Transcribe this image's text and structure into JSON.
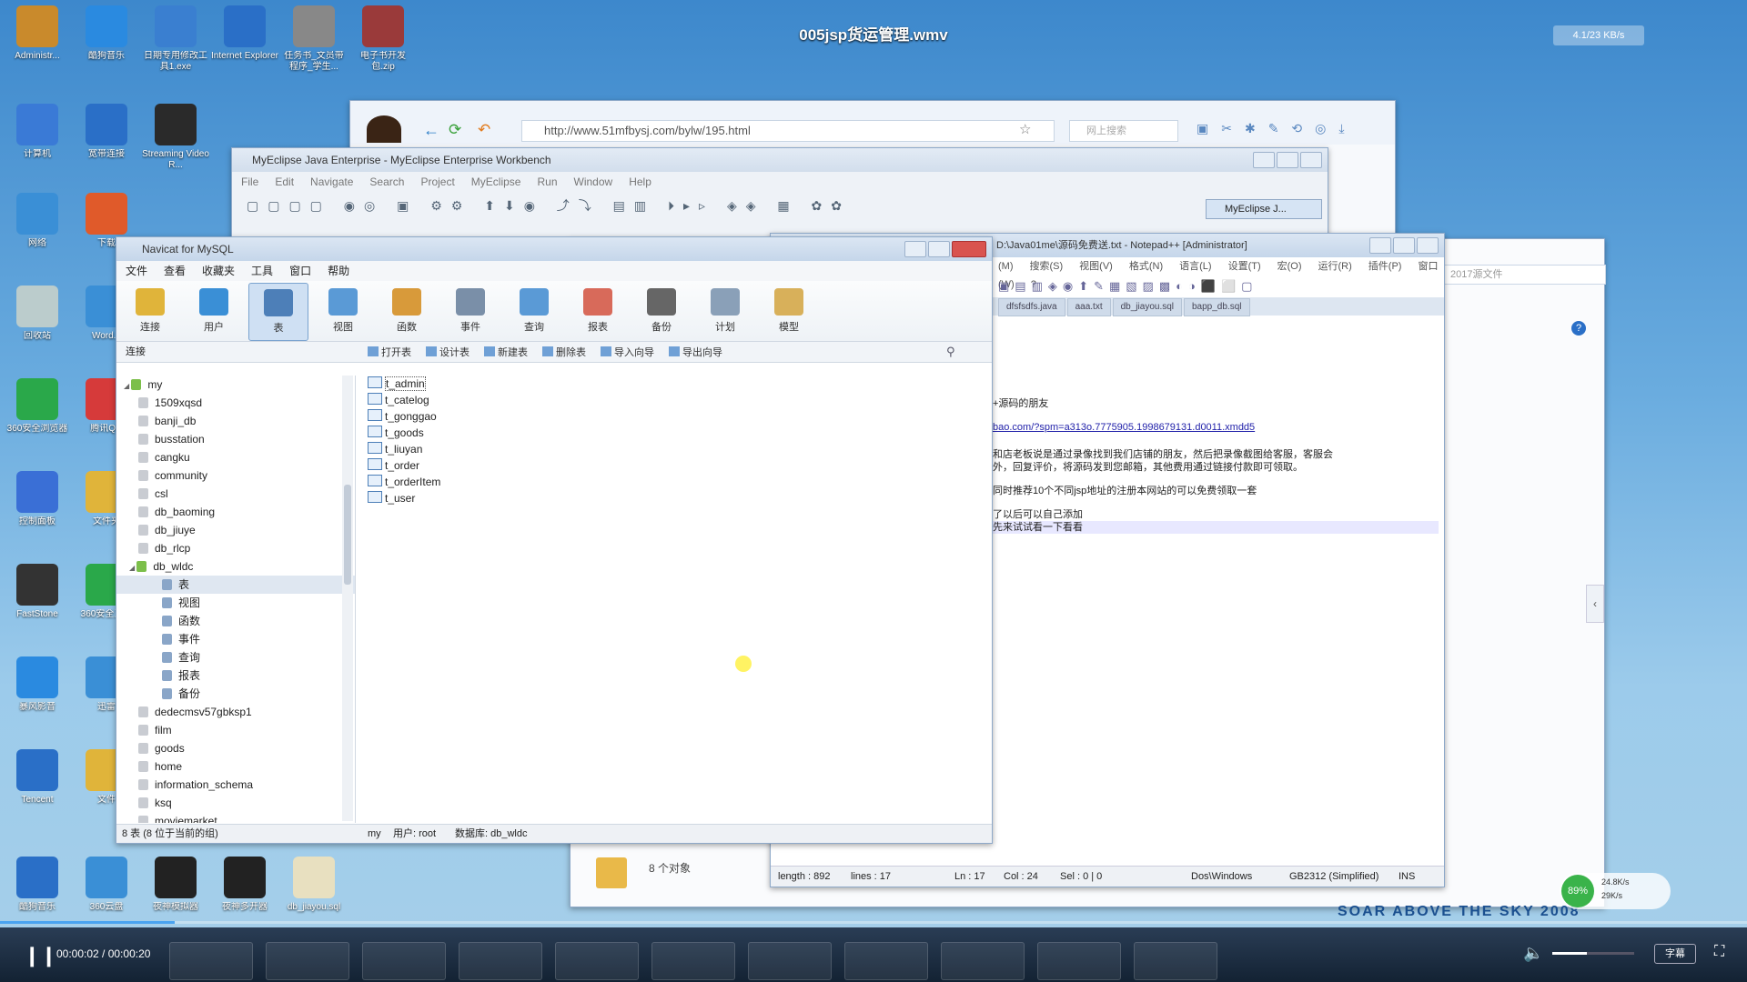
{
  "video": {
    "title": "005jsp货运管理.wmv",
    "net_speed": "4.1/23 KB/s",
    "time": "00:00:02 / 00:00:20",
    "progress": 0.1,
    "subtitle_btn": "字幕"
  },
  "desktop_icons": [
    {
      "label": "Administr..."
    },
    {
      "label": "酷狗音乐"
    },
    {
      "label": "日期专用修改工具1.exe"
    },
    {
      "label": "Internet Explorer"
    },
    {
      "label": "任务书_文员带程序_学生..."
    },
    {
      "label": "电子书开发包.zip"
    },
    {
      "label": "计算机"
    },
    {
      "label": "宽带连接"
    },
    {
      "label": "Streaming Video R..."
    },
    {
      "label": "网络"
    },
    {
      "label": "下载"
    },
    {
      "label": "回收站"
    },
    {
      "label": "Word..."
    },
    {
      "label": "360安全浏览器"
    },
    {
      "label": "腾讯QQ"
    },
    {
      "label": "控制面板"
    },
    {
      "label": "文件夹"
    },
    {
      "label": "FastStone"
    },
    {
      "label": "360安全卫士"
    },
    {
      "label": "暴风影音"
    },
    {
      "label": "迅雷"
    },
    {
      "label": "Tencent"
    },
    {
      "label": "文件"
    }
  ],
  "desktop_bottom": [
    {
      "label": "酷狗音乐"
    },
    {
      "label": "360云盘"
    },
    {
      "label": "夜神模拟器"
    },
    {
      "label": "夜神多开器"
    },
    {
      "label": "db_jiayou.sql"
    }
  ],
  "browser": {
    "url": "http://www.51mfbysj.com/bylw/195.html",
    "search_placeholder": "网上搜索"
  },
  "myeclipse": {
    "title": "MyEclipse Java Enterprise - MyEclipse Enterprise Workbench",
    "menus": [
      "File",
      "Edit",
      "Navigate",
      "Search",
      "Project",
      "MyEclipse",
      "Run",
      "Window",
      "Help"
    ],
    "perspective": "MyEclipse J..."
  },
  "navicat": {
    "title": "Navicat for MySQL",
    "menus": [
      "文件",
      "查看",
      "收藏夹",
      "工具",
      "窗口",
      "帮助"
    ],
    "tools": [
      {
        "label": "连接",
        "color": "#e0b43a"
      },
      {
        "label": "用户",
        "color": "#3a8fd6"
      },
      {
        "label": "表",
        "color": "#4d7fb8"
      },
      {
        "label": "视图",
        "color": "#5a9ad6"
      },
      {
        "label": "函数",
        "color": "#d89a3a"
      },
      {
        "label": "事件",
        "color": "#7a8fa8"
      },
      {
        "label": "查询",
        "color": "#5a9ad6"
      },
      {
        "label": "报表",
        "color": "#d86a5a"
      },
      {
        "label": "备份",
        "color": "#666666"
      },
      {
        "label": "计划",
        "color": "#8aa0b8"
      },
      {
        "label": "模型",
        "color": "#d8b05a"
      }
    ],
    "conn_header": "连接",
    "subtools": [
      "打开表",
      "设计表",
      "新建表",
      "删除表",
      "导入向导",
      "导出向导"
    ],
    "tree": [
      {
        "label": "my",
        "level": 0,
        "type": "conn"
      },
      {
        "label": "1509xqsd",
        "level": 1
      },
      {
        "label": "banji_db",
        "level": 1
      },
      {
        "label": "busstation",
        "level": 1
      },
      {
        "label": "cangku",
        "level": 1
      },
      {
        "label": "community",
        "level": 1
      },
      {
        "label": "csl",
        "level": 1
      },
      {
        "label": "db_baoming",
        "level": 1
      },
      {
        "label": "db_jiuye",
        "level": 1
      },
      {
        "label": "db_rlcp",
        "level": 1
      },
      {
        "label": "db_wldc",
        "level": 1,
        "open": true
      },
      {
        "label": "表",
        "level": 2,
        "selected": true
      },
      {
        "label": "视图",
        "level": 2
      },
      {
        "label": "函数",
        "level": 2
      },
      {
        "label": "事件",
        "level": 2
      },
      {
        "label": "查询",
        "level": 2
      },
      {
        "label": "报表",
        "level": 2
      },
      {
        "label": "备份",
        "level": 2
      },
      {
        "label": "dedecmsv57gbksp1",
        "level": 1
      },
      {
        "label": "film",
        "level": 1
      },
      {
        "label": "goods",
        "level": 1
      },
      {
        "label": "home",
        "level": 1
      },
      {
        "label": "information_schema",
        "level": 1
      },
      {
        "label": "ksq",
        "level": 1
      },
      {
        "label": "moviemarket",
        "level": 1
      }
    ],
    "tables": [
      "t_admin",
      "t_catelog",
      "t_gonggao",
      "t_goods",
      "t_liuyan",
      "t_order",
      "t_orderItem",
      "t_user"
    ],
    "status_left": "8 表 (8 位于当前的组)",
    "status_conn": "my",
    "status_user": "用户: root",
    "status_db": "数据库: db_wldc"
  },
  "notepad": {
    "title": "D:\\Java01me\\源码免费送.txt - Notepad++ [Administrator]",
    "menus": [
      "(M)",
      "搜索(S)",
      "视图(V)",
      "格式(N)",
      "语言(L)",
      "设置(T)",
      "宏(O)",
      "运行(R)",
      "插件(P)",
      "窗口(W)",
      "?"
    ],
    "tabs": [
      "dfsfsdfs.java",
      "aaa.txt",
      "db_jiayou.sql",
      "bapp_db.sql"
    ],
    "lines": [
      "+源码的朋友",
      "bao.com/?spm=a313o.7775905.1998679131.d0011.xmdd5",
      "和店老板说是通过录像找到我们店铺的朋友，然后把录像截图给客服，客服会",
      "外，回复评价，将源码发到您邮箱，其他费用通过链接付款即可领取。",
      "同时推荐10个不同jsp地址的注册本网站的可以免费领取一套",
      "了以后可以自己添加",
      "先来试试看一下看看"
    ],
    "status": {
      "length": "length : 892",
      "lines": "lines : 17",
      "ln": "Ln : 17",
      "col": "Col : 24",
      "sel": "Sel : 0 | 0",
      "eol": "Dos\\Windows",
      "enc": "GB2312 (Simplified)",
      "ins": "INS"
    }
  },
  "explorer": {
    "address": "2017源文件",
    "objects": "8 个对象"
  },
  "widget": {
    "percent": "89%",
    "up": "24.8K/s",
    "down": "29K/s"
  },
  "banner": "SOAR ABOVE THE SKY 2008"
}
